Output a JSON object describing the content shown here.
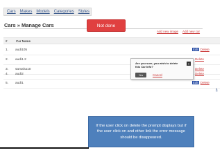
{
  "nav": {
    "items": [
      "Cars",
      "Makes",
      "Models",
      "Categories",
      "Styles"
    ]
  },
  "page": {
    "title": "Cars » Manage Cars"
  },
  "sticky_label": "Not done",
  "links": {
    "add_new_image": "Add new image",
    "add_new_car": "Add new car"
  },
  "table": {
    "headers": [
      "#",
      "Car Name"
    ],
    "rows": [
      {
        "num": "1.",
        "name": "audi105",
        "edit": "Edit",
        "delete": "Delete"
      },
      {
        "num": "2.",
        "name": "audi1.2",
        "edit": "",
        "delete": "Delete"
      },
      {
        "num": "3.",
        "name": "samaha10",
        "edit": "",
        "delete": "Delete"
      },
      {
        "num": "4.",
        "name": "audi2",
        "edit": "",
        "delete": "Delete"
      },
      {
        "num": "5.",
        "name": "audi1",
        "edit": "Edit",
        "delete": "Delete"
      }
    ],
    "pagination": "1"
  },
  "dialog": {
    "message": "Are you sure, you wish to delete this Car Info?",
    "yes_label": "Yes",
    "cancel_label": "Cancel",
    "close_glyph": "×"
  },
  "note": {
    "text": "If the user click on delete the prompt displays but if the user click on and other link the error message should be disappeared."
  },
  "colors": {
    "sticky_bg": "#e04040",
    "note_bg": "#4e80bc",
    "link_red": "#cc3b3b",
    "edit_blue": "#2b4fa6"
  }
}
